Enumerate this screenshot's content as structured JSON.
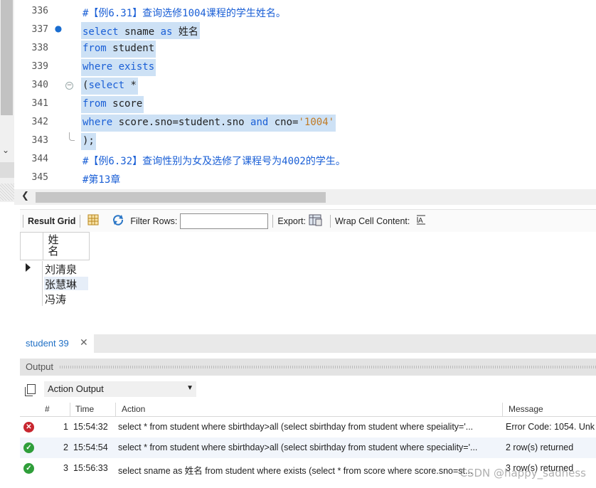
{
  "editor": {
    "lines": [
      {
        "num": "336",
        "parts": [
          {
            "t": "#【例6.31】查询选修1004课程的学生姓名。",
            "c": "cm"
          }
        ]
      },
      {
        "num": "337",
        "marker": "●",
        "parts": [
          {
            "t": "select",
            "c": "kw"
          },
          {
            "t": " sname ",
            "c": "plain"
          },
          {
            "t": "as",
            "c": "kw"
          },
          {
            "t": " 姓名",
            "c": "plain"
          }
        ]
      },
      {
        "num": "338",
        "parts": [
          {
            "t": "from",
            "c": "kw"
          },
          {
            "t": " student",
            "c": "plain"
          }
        ]
      },
      {
        "num": "339",
        "parts": [
          {
            "t": "where exists",
            "c": "kw"
          }
        ]
      },
      {
        "num": "340",
        "fold": "−",
        "parts": [
          {
            "t": "(",
            "c": "plain"
          },
          {
            "t": "select",
            "c": "kw"
          },
          {
            "t": " *",
            "c": "plain"
          }
        ]
      },
      {
        "num": "341",
        "parts": [
          {
            "t": "from",
            "c": "kw"
          },
          {
            "t": " score",
            "c": "plain"
          }
        ]
      },
      {
        "num": "342",
        "parts": [
          {
            "t": "where",
            "c": "kw"
          },
          {
            "t": " score.sno=student.sno ",
            "c": "plain"
          },
          {
            "t": "and",
            "c": "kw"
          },
          {
            "t": " cno=",
            "c": "plain"
          },
          {
            "t": "'1004'",
            "c": "str"
          }
        ]
      },
      {
        "num": "343",
        "foldend": true,
        "parts": [
          {
            "t": ");",
            "c": "plain"
          }
        ]
      },
      {
        "num": "344",
        "parts": [
          {
            "t": "#【例6.32】查询性别为女及选修了课程号为4002的学生。",
            "c": "cm"
          }
        ]
      },
      {
        "num": "345",
        "parts": [
          {
            "t": "#第13章",
            "c": "cm"
          }
        ]
      }
    ],
    "selected_lines": [
      "337",
      "338",
      "339",
      "340",
      "341",
      "342",
      "343"
    ]
  },
  "result_toolbar": {
    "result_grid": "Result Grid",
    "filter_rows": "Filter Rows:",
    "filter_value": "",
    "export": "Export:",
    "wrap_cell": "Wrap Cell Content:"
  },
  "result_grid": {
    "column_header": "姓名",
    "rows": [
      "刘清泉",
      "张慧琳",
      "冯涛"
    ]
  },
  "tabs": {
    "active": "student 39"
  },
  "output": {
    "title": "Output",
    "selector": "Action Output",
    "columns": {
      "num": "#",
      "time": "Time",
      "action": "Action",
      "message": "Message"
    },
    "rows": [
      {
        "status": "error",
        "num": "1",
        "time": "15:54:32",
        "action": "select * from student where sbirthday>all (select sbirthday from student where speiality='...",
        "message": "Error Code: 1054. Unk"
      },
      {
        "status": "ok",
        "num": "2",
        "time": "15:54:54",
        "action": "select * from student where sbirthday>all (select sbirthday from student where speciality='...",
        "message": "2 row(s) returned"
      },
      {
        "status": "ok",
        "num": "3",
        "time": "15:56:33",
        "action": "select sname as 姓名 from student where exists (select * from score where score.sno=st...",
        "message": "3 row(s) returned"
      }
    ]
  },
  "watermark": "CSDN @happy_sadness",
  "colors": {
    "keyword": "#1a5fd6",
    "string": "#c07a24",
    "selection": "#cde1f5",
    "error": "#c8262f",
    "ok": "#2f9e3a"
  }
}
